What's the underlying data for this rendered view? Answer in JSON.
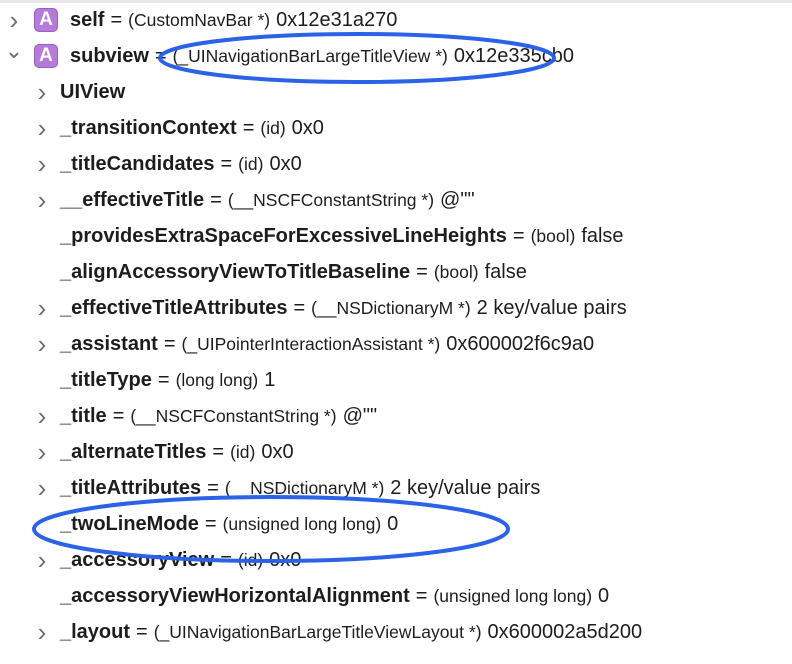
{
  "accent_color": "#2b62e8",
  "rows": [
    {
      "level": 0,
      "expanded": false,
      "has_chevron": true,
      "badge": "A",
      "name": "self",
      "type": "(CustomNavBar *)",
      "value": "0x12e31a270"
    },
    {
      "level": 0,
      "expanded": true,
      "has_chevron": true,
      "badge": "A",
      "name": "subview",
      "type": "(_UINavigationBarLargeTitleView *)",
      "value": "0x12e335cb0"
    },
    {
      "level": 1,
      "expanded": false,
      "has_chevron": true,
      "name": "UIView",
      "type": "",
      "value": ""
    },
    {
      "level": 1,
      "expanded": false,
      "has_chevron": true,
      "name": "_transitionContext",
      "type": "(id)",
      "value": "0x0"
    },
    {
      "level": 1,
      "expanded": false,
      "has_chevron": true,
      "name": "_titleCandidates",
      "type": "(id)",
      "value": "0x0"
    },
    {
      "level": 1,
      "expanded": false,
      "has_chevron": true,
      "name": "__effectiveTitle",
      "type": "(__NSCFConstantString *)",
      "value": "@\"\""
    },
    {
      "level": 1,
      "expanded": false,
      "has_chevron": false,
      "name": "_providesExtraSpaceForExcessiveLineHeights",
      "type": "(bool)",
      "value": "false"
    },
    {
      "level": 1,
      "expanded": false,
      "has_chevron": false,
      "name": "_alignAccessoryViewToTitleBaseline",
      "type": "(bool)",
      "value": "false"
    },
    {
      "level": 1,
      "expanded": false,
      "has_chevron": true,
      "name": "_effectiveTitleAttributes",
      "type": "(__NSDictionaryM *)",
      "value": "2 key/value pairs"
    },
    {
      "level": 1,
      "expanded": false,
      "has_chevron": true,
      "name": "_assistant",
      "type": "(_UIPointerInteractionAssistant *)",
      "value": "0x600002f6c9a0"
    },
    {
      "level": 1,
      "expanded": false,
      "has_chevron": false,
      "name": "_titleType",
      "type": "(long long)",
      "value": "1"
    },
    {
      "level": 1,
      "expanded": false,
      "has_chevron": true,
      "name": "_title",
      "type": "(__NSCFConstantString *)",
      "value": "@\"\""
    },
    {
      "level": 1,
      "expanded": false,
      "has_chevron": true,
      "name": "_alternateTitles",
      "type": "(id)",
      "value": "0x0"
    },
    {
      "level": 1,
      "expanded": false,
      "has_chevron": true,
      "name": "_titleAttributes",
      "type": "(__NSDictionaryM *)",
      "value": "2 key/value pairs"
    },
    {
      "level": 1,
      "expanded": false,
      "has_chevron": false,
      "name": "_twoLineMode",
      "type": "(unsigned long long)",
      "value": "0"
    },
    {
      "level": 1,
      "expanded": false,
      "has_chevron": true,
      "name": "_accessoryView",
      "type": "(id)",
      "value": "0x0"
    },
    {
      "level": 1,
      "expanded": false,
      "has_chevron": false,
      "name": "_accessoryViewHorizontalAlignment",
      "type": "(unsigned long long)",
      "value": "0"
    },
    {
      "level": 1,
      "expanded": false,
      "has_chevron": true,
      "name": "_layout",
      "type": "(_UINavigationBarLargeTitleViewLayout *)",
      "value": "0x600002a5d200"
    }
  ]
}
